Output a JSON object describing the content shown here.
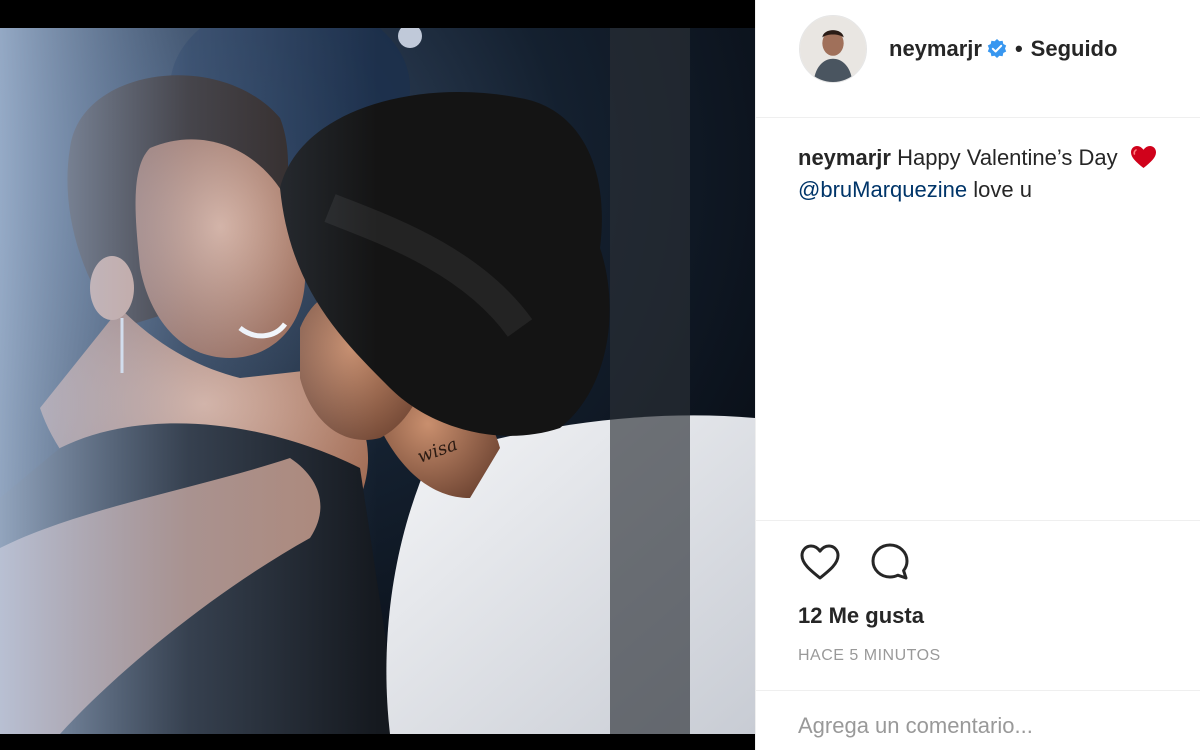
{
  "post": {
    "username": "neymarjr",
    "verified": true,
    "separator": "•",
    "follow_status": "Seguido",
    "caption_text": "Happy Valentine’s Day",
    "caption_emoji": "red-heart",
    "mention": "@bruMarquezine",
    "caption_tail": "love u",
    "likes": "12 Me gusta",
    "timestamp": "HACE 5 MINUTOS",
    "comment_placeholder": "Agrega un comentario..."
  },
  "icons": {
    "like": "heart-outline-icon",
    "comment": "speech-bubble-icon",
    "verified": "verified-badge-icon"
  },
  "colors": {
    "text": "#262626",
    "mention": "#003569",
    "muted": "#999999",
    "verified": "#3897f0",
    "emoji_heart": "#d0021b"
  }
}
